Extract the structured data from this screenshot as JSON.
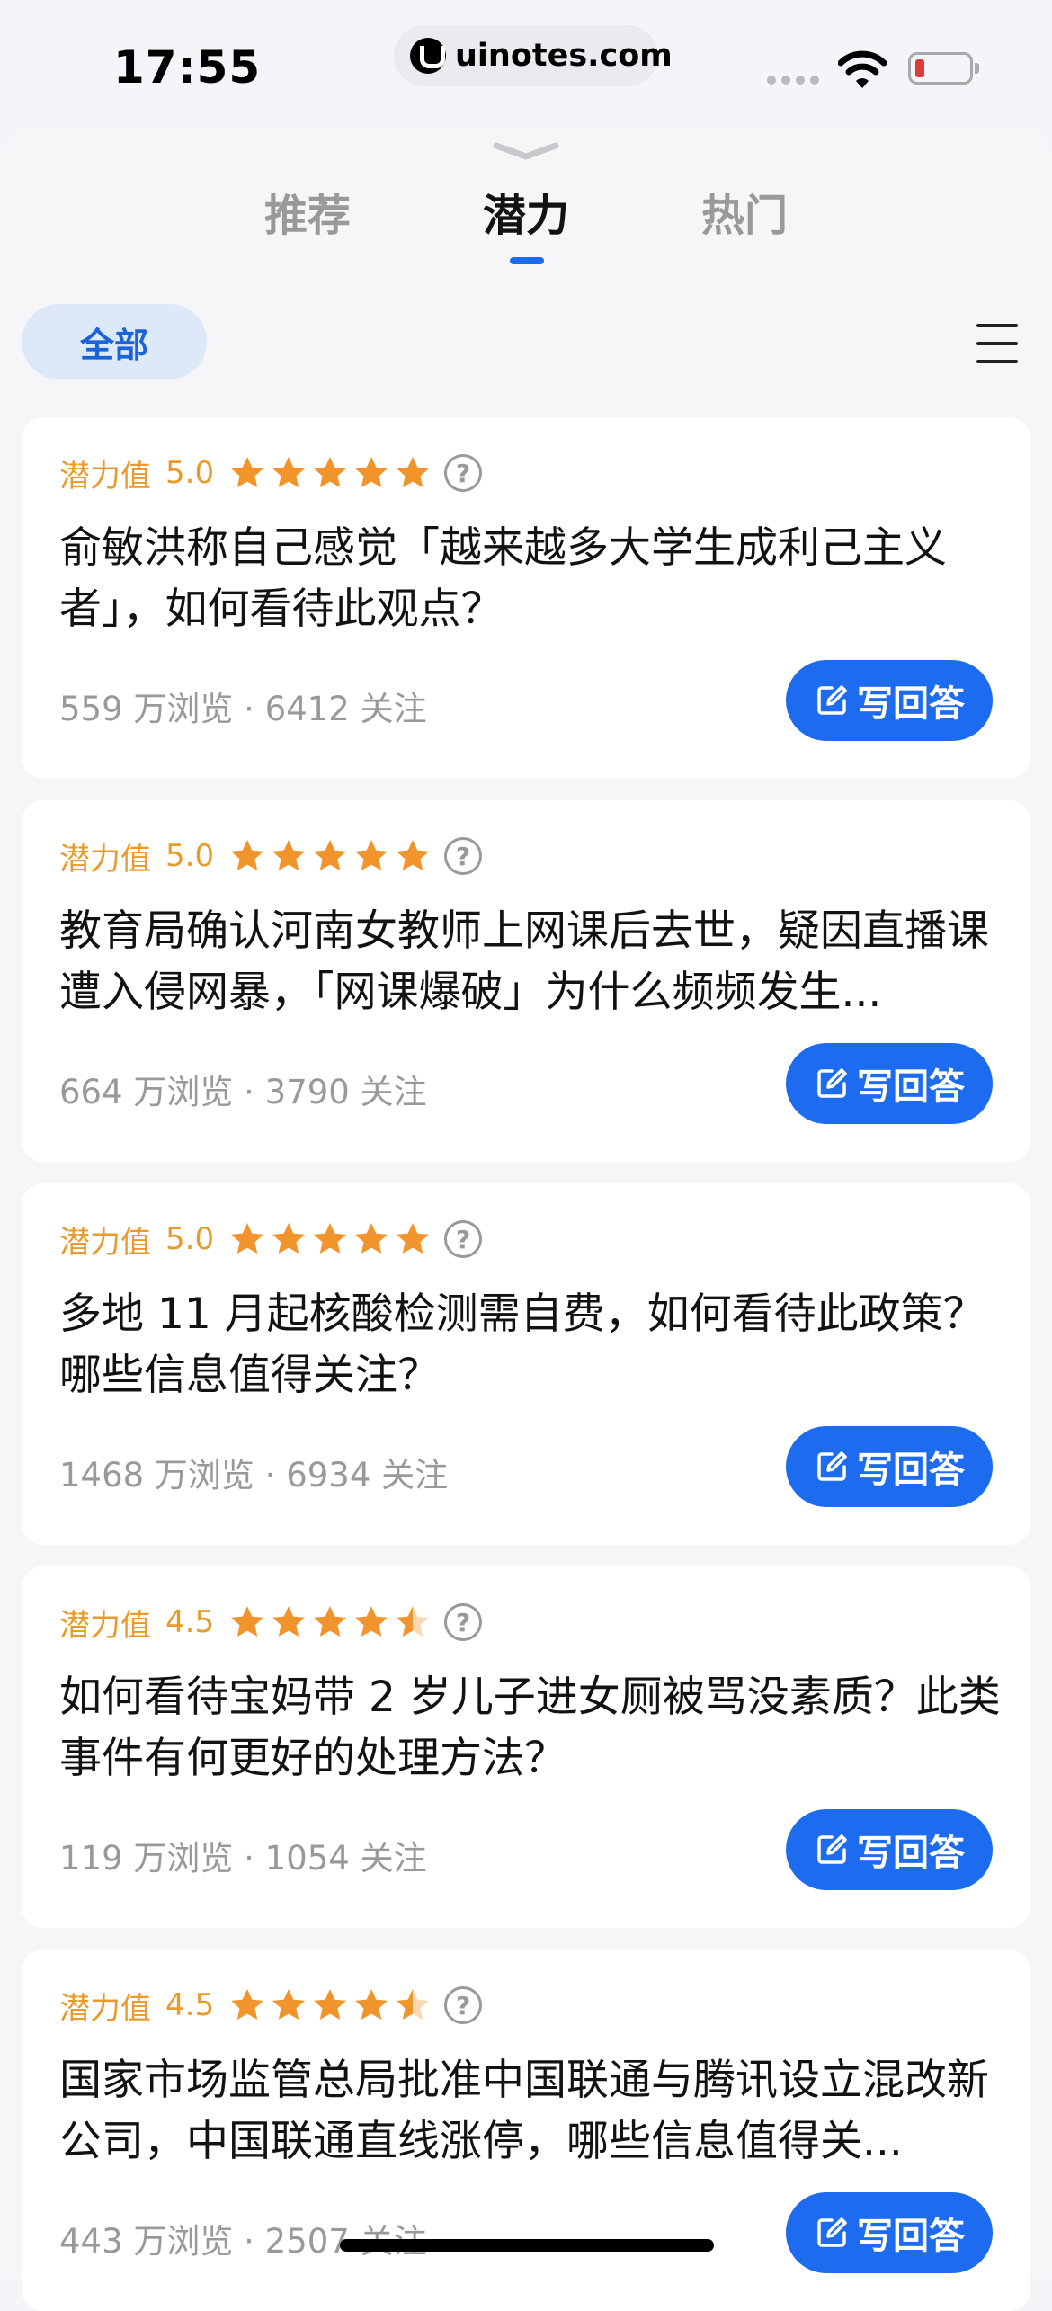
{
  "status_bar": {
    "time": "17:55",
    "url": "uinotes.com",
    "battery_color": "#e03a3a"
  },
  "tabs": [
    {
      "label": "推荐",
      "active": false
    },
    {
      "label": "潜力",
      "active": true
    },
    {
      "label": "热门",
      "active": false
    }
  ],
  "filter": {
    "label": "全部"
  },
  "colors": {
    "accent": "#1d6cf0",
    "potential": "#e89a2c",
    "star": "#f2942c"
  },
  "cards": [
    {
      "potential_label": "潜力值",
      "score": "5.0",
      "rating": 5,
      "title": "俞敏洪称自己感觉「越来越多大学生成利己主义者」，如何看待此观点？",
      "stats": "559 万浏览 · 6412 关注",
      "button": "写回答"
    },
    {
      "potential_label": "潜力值",
      "score": "5.0",
      "rating": 5,
      "title": "教育局确认河南女教师上网课后去世，疑因直播课遭入侵网暴，「网课爆破」为什么频频发生...",
      "stats": "664 万浏览 · 3790 关注",
      "button": "写回答"
    },
    {
      "potential_label": "潜力值",
      "score": "5.0",
      "rating": 5,
      "title": "多地 11 月起核酸检测需自费，如何看待此政策？哪些信息值得关注？",
      "stats": "1468 万浏览 · 6934 关注",
      "button": "写回答"
    },
    {
      "potential_label": "潜力值",
      "score": "4.5",
      "rating": 4.5,
      "title": "如何看待宝妈带 2 岁儿子进女厕被骂没素质？此类事件有何更好的处理方法？",
      "stats": "119 万浏览 · 1054 关注",
      "button": "写回答"
    },
    {
      "potential_label": "潜力值",
      "score": "4.5",
      "rating": 4.5,
      "title": "国家市场监管总局批准中国联通与腾讯设立混改新公司，中国联通直线涨停，哪些信息值得关...",
      "stats": "443 万浏览 · 2507 关注",
      "button": "写回答"
    }
  ]
}
